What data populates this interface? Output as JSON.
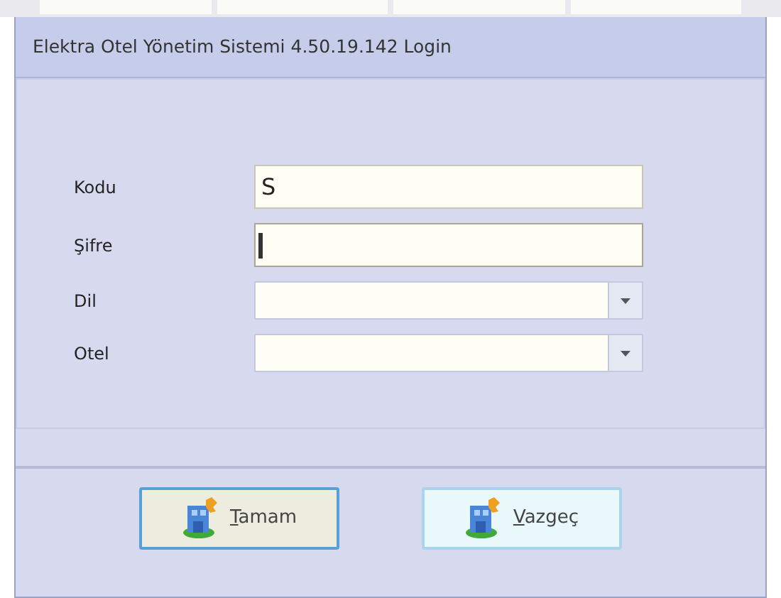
{
  "window": {
    "title": "Elektra Otel Yönetim Sistemi 4.50.19.142 Login"
  },
  "fields": [
    {
      "kind": "text",
      "label": "Kodu",
      "value": "S",
      "focused": false
    },
    {
      "kind": "text",
      "label": "Şifre",
      "focused": true
    },
    {
      "kind": "combo",
      "label": "Dil"
    },
    {
      "kind": "combo",
      "label": "Otel"
    }
  ],
  "buttons": [
    {
      "label": "Tamam",
      "default": true
    },
    {
      "label": "Vazgeç",
      "default": false
    }
  ]
}
